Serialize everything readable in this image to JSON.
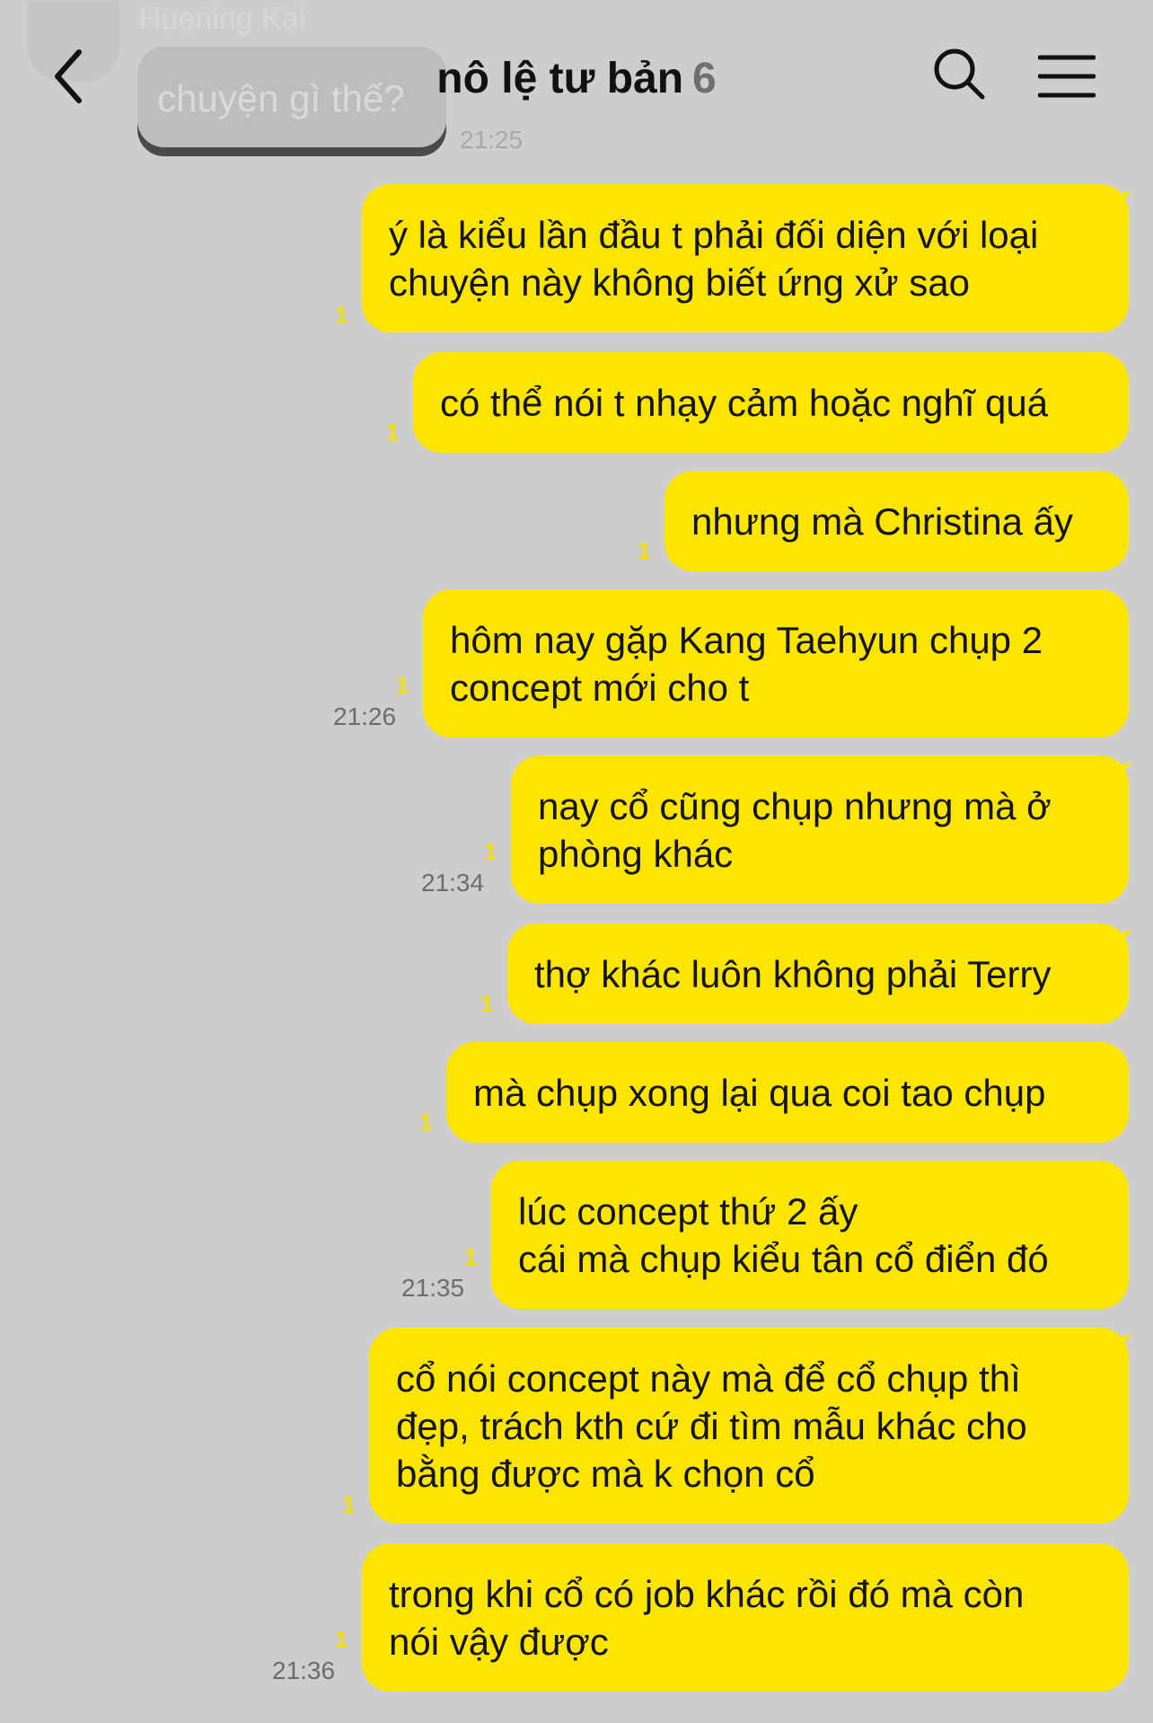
{
  "previous_message": {
    "sender": "Huening Kai",
    "text": "chuyện gì thế?",
    "time": "21:25"
  },
  "header": {
    "title": "nô lệ tư bản",
    "member_count": "6",
    "back_icon": "chevron-left-icon",
    "search_icon": "search-icon",
    "menu_icon": "hamburger-menu-icon"
  },
  "colors": {
    "background": "#cdcdcd",
    "my_bubble": "#fee500",
    "unread_count": "#f5e000"
  },
  "messages": [
    {
      "text": "ý là kiểu lần đầu t phải đối diện với loại\nchuyện này không biết ứng xử sao",
      "unread": "1",
      "time": ""
    },
    {
      "text": "có thể nói t nhạy cảm hoặc nghĩ quá",
      "unread": "1",
      "time": ""
    },
    {
      "text": "nhưng mà Christina ấy",
      "unread": "1",
      "time": ""
    },
    {
      "text": "hôm nay gặp Kang Taehyun chụp 2\nconcept mới cho t",
      "unread": "1",
      "time": "21:26"
    },
    {
      "text": "nay cổ cũng chụp nhưng mà ở\nphòng khác",
      "unread": "1",
      "time": "21:34"
    },
    {
      "text": "thợ khác luôn không phải Terry",
      "unread": "1",
      "time": ""
    },
    {
      "text": "mà chụp xong lại qua coi tao chụp",
      "unread": "1",
      "time": ""
    },
    {
      "text": "lúc concept thứ 2 ấy\ncái mà chụp kiểu tân cổ điển đó",
      "unread": "1",
      "time": "21:35"
    },
    {
      "text": "cổ nói concept này mà để cổ chụp thì\nđẹp, trách kth cứ đi tìm mẫu khác cho\nbằng được mà k chọn cổ",
      "unread": "1",
      "time": ""
    },
    {
      "text": "trong khi cổ có job khác rồi đó mà còn\nnói vậy được",
      "unread": "1",
      "time": "21:36"
    }
  ]
}
